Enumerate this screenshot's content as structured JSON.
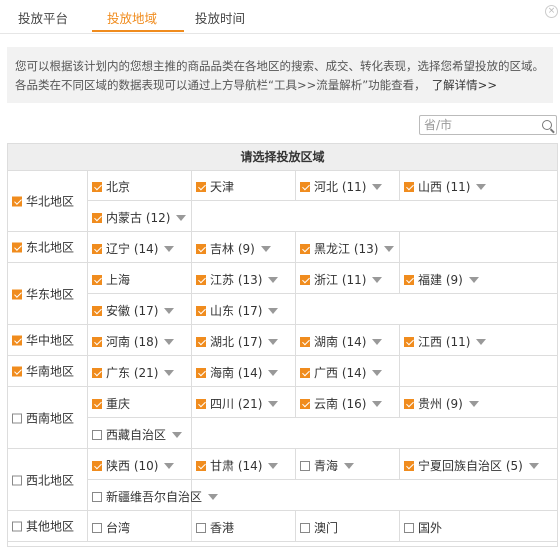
{
  "tabs": [
    {
      "label": "投放平台",
      "active": false
    },
    {
      "label": "投放地域",
      "active": true
    },
    {
      "label": "投放时间",
      "active": false
    }
  ],
  "info": {
    "text": "您可以根据该计划内的您想主推的商品品类在各地区的搜索、成交、转化表现，选择您希望投放的区域。各品类在不同区域的数据表现可以通过上方导航栏“工具>>流量解析”功能查看，",
    "link": "了解详情>>"
  },
  "search": {
    "placeholder": "省/市"
  },
  "table_header": "请选择投放区域",
  "accent_color": "#f08c1e",
  "regions": [
    {
      "name": "华北地区",
      "checked": true,
      "rows": [
        [
          {
            "label": "北京",
            "checked": true,
            "caret": false
          },
          {
            "label": "天津",
            "checked": true,
            "caret": false
          },
          {
            "label": "河北 (11)",
            "checked": true,
            "caret": true
          },
          {
            "label": "山西 (11)",
            "checked": true,
            "caret": true
          }
        ],
        [
          {
            "label": "内蒙古 (12)",
            "checked": true,
            "caret": true
          }
        ]
      ]
    },
    {
      "name": "东北地区",
      "checked": true,
      "rows": [
        [
          {
            "label": "辽宁 (14)",
            "checked": true,
            "caret": true
          },
          {
            "label": "吉林 (9)",
            "checked": true,
            "caret": true
          },
          {
            "label": "黑龙江 (13)",
            "checked": true,
            "caret": true
          }
        ]
      ]
    },
    {
      "name": "华东地区",
      "checked": true,
      "rows": [
        [
          {
            "label": "上海",
            "checked": true,
            "caret": false
          },
          {
            "label": "江苏 (13)",
            "checked": true,
            "caret": true
          },
          {
            "label": "浙江 (11)",
            "checked": true,
            "caret": true
          },
          {
            "label": "福建 (9)",
            "checked": true,
            "caret": true
          }
        ],
        [
          {
            "label": "安徽 (17)",
            "checked": true,
            "caret": true
          },
          {
            "label": "山东 (17)",
            "checked": true,
            "caret": true
          }
        ]
      ]
    },
    {
      "name": "华中地区",
      "checked": true,
      "rows": [
        [
          {
            "label": "河南 (18)",
            "checked": true,
            "caret": true
          },
          {
            "label": "湖北 (17)",
            "checked": true,
            "caret": true
          },
          {
            "label": "湖南 (14)",
            "checked": true,
            "caret": true
          },
          {
            "label": "江西 (11)",
            "checked": true,
            "caret": true
          }
        ]
      ]
    },
    {
      "name": "华南地区",
      "checked": true,
      "rows": [
        [
          {
            "label": "广东 (21)",
            "checked": true,
            "caret": true
          },
          {
            "label": "海南 (14)",
            "checked": true,
            "caret": true
          },
          {
            "label": "广西 (14)",
            "checked": true,
            "caret": true
          }
        ]
      ]
    },
    {
      "name": "西南地区",
      "checked": false,
      "rows": [
        [
          {
            "label": "重庆",
            "checked": true,
            "caret": false
          },
          {
            "label": "四川 (21)",
            "checked": true,
            "caret": true
          },
          {
            "label": "云南 (16)",
            "checked": true,
            "caret": true
          },
          {
            "label": "贵州 (9)",
            "checked": true,
            "caret": true
          }
        ],
        [
          {
            "label": "西藏自治区",
            "checked": false,
            "caret": true
          }
        ]
      ]
    },
    {
      "name": "西北地区",
      "checked": false,
      "rows": [
        [
          {
            "label": "陕西 (10)",
            "checked": true,
            "caret": true
          },
          {
            "label": "甘肃 (14)",
            "checked": true,
            "caret": true
          },
          {
            "label": "青海",
            "checked": false,
            "caret": true
          },
          {
            "label": "宁夏回族自治区 (5)",
            "checked": true,
            "caret": true
          }
        ],
        [
          {
            "label": "新疆维吾尔自治区",
            "checked": false,
            "caret": true
          }
        ]
      ]
    },
    {
      "name": "其他地区",
      "checked": false,
      "rows": [
        [
          {
            "label": "台湾",
            "checked": false,
            "caret": false
          },
          {
            "label": "香港",
            "checked": false,
            "caret": false
          },
          {
            "label": "澳门",
            "checked": false,
            "caret": false
          },
          {
            "label": "国外",
            "checked": false,
            "caret": false
          }
        ]
      ]
    }
  ]
}
